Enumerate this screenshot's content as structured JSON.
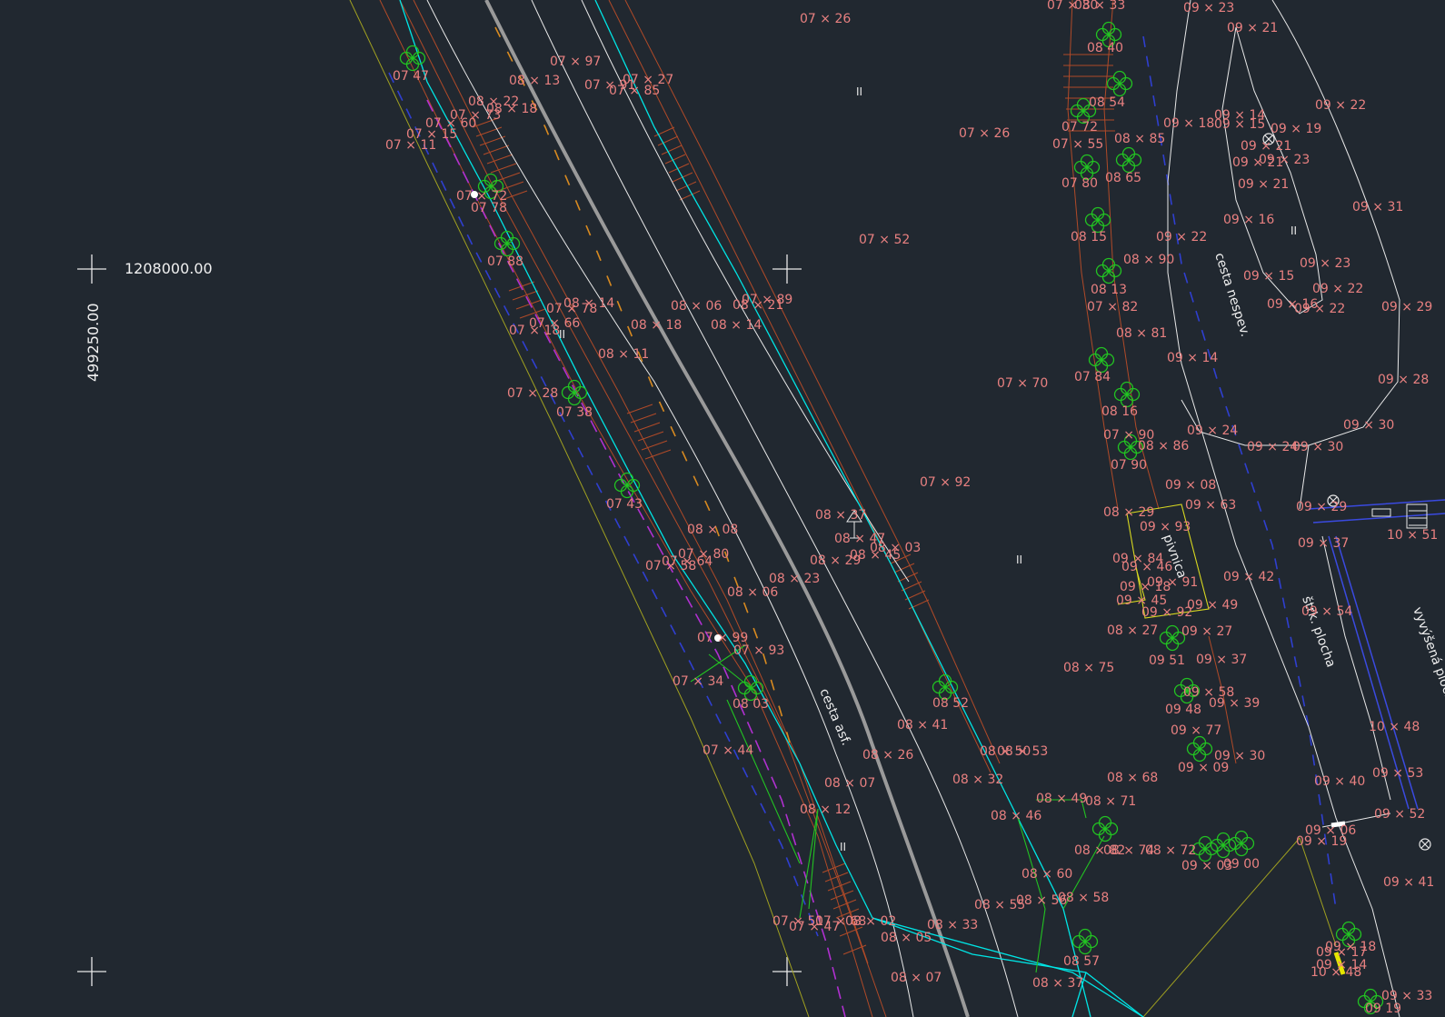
{
  "colors": {
    "background": "#212830",
    "point_label": "#e88080",
    "point_marker": "#e6e600",
    "tree": "#22c322",
    "cyan_line": "#00e5e5",
    "white_line": "#e8e8e8",
    "brown_line": "#b04a28",
    "olive_line": "#a0a020",
    "blue_dash": "#2f3fd0",
    "purple_dash": "#b030d0",
    "orange_dash": "#d88a20",
    "gray_road": "#9a9a9a",
    "yellow_line": "#d8d820"
  },
  "grid": {
    "x_coord": "1208000.00",
    "y_coord": "499250.00"
  },
  "area_labels": {
    "road_asphalt": "cesta  asf.",
    "road_unpaved": "cesta  nespev.",
    "gravel_area": "štrk.  plocha",
    "raised_area": "vyvýšená  plocha",
    "cellar": "pivnica"
  },
  "hatch_marks": [
    "II",
    "II",
    "II",
    "II",
    "II",
    "II"
  ],
  "points": [
    {
      "label": "07 × 26"
    },
    {
      "label": "07 × 26"
    },
    {
      "label": "07 × 52"
    },
    {
      "label": "07 × 70"
    },
    {
      "label": "07 × 92"
    },
    {
      "label": "07 × 97"
    },
    {
      "label": "08 × 13"
    },
    {
      "label": "07 × 91"
    },
    {
      "label": "07 × 27"
    },
    {
      "label": "07 × 85"
    },
    {
      "label": "08 × 22"
    },
    {
      "label": "08 × 18"
    },
    {
      "label": "07 × 73"
    },
    {
      "label": "07 × 60"
    },
    {
      "label": "07 × 15"
    },
    {
      "label": "07 × 11"
    },
    {
      "label": "07   47"
    },
    {
      "label": "07 × 72"
    },
    {
      "label": "07   78"
    },
    {
      "label": "07   88"
    },
    {
      "label": "08 × 14"
    },
    {
      "label": "07 × 78"
    },
    {
      "label": "07 × 66"
    },
    {
      "label": "07 × 18"
    },
    {
      "label": "08 × 06"
    },
    {
      "label": "07 × 89"
    },
    {
      "label": "08 × 21"
    },
    {
      "label": "08 × 18"
    },
    {
      "label": "08 × 14"
    },
    {
      "label": "08 × 11"
    },
    {
      "label": "07 × 28"
    },
    {
      "label": "07   38"
    },
    {
      "label": "07   43"
    },
    {
      "label": "08 × 08"
    },
    {
      "label": "07 × 80"
    },
    {
      "label": "07 × 64"
    },
    {
      "label": "07 × 58"
    },
    {
      "label": "08 × 06"
    },
    {
      "label": "08 × 23"
    },
    {
      "label": "07 × 99"
    },
    {
      "label": "07 × 93"
    },
    {
      "label": "07 × 34"
    },
    {
      "label": "08   03"
    },
    {
      "label": "07 × 44"
    },
    {
      "label": "08 × 37"
    },
    {
      "label": "08 × 47"
    },
    {
      "label": "08 × 29"
    },
    {
      "label": "08 × 45"
    },
    {
      "label": "08 × 03"
    },
    {
      "label": "08 × 41"
    },
    {
      "label": "08   52"
    },
    {
      "label": "08 × 26"
    },
    {
      "label": "08 × 07"
    },
    {
      "label": "08 × 12"
    },
    {
      "label": "08 × 50"
    },
    {
      "label": "08 × 53"
    },
    {
      "label": "08 × 32"
    },
    {
      "label": "07 × 51"
    },
    {
      "label": "07 × 47"
    },
    {
      "label": "07 × 68"
    },
    {
      "label": "08 × 02"
    },
    {
      "label": "08 × 05"
    },
    {
      "label": "08 × 33"
    },
    {
      "label": "08 × 07"
    },
    {
      "label": "07 × 30"
    },
    {
      "label": "08 × 33"
    },
    {
      "label": "08   40"
    },
    {
      "label": "08   54"
    },
    {
      "label": "07   72"
    },
    {
      "label": "07 × 55"
    },
    {
      "label": "08 × 85"
    },
    {
      "label": "07   80"
    },
    {
      "label": "08   65"
    },
    {
      "label": "08   15"
    },
    {
      "label": "08 × 90"
    },
    {
      "label": "08   13"
    },
    {
      "label": "07 × 82"
    },
    {
      "label": "08 × 81"
    },
    {
      "label": "07   84"
    },
    {
      "label": "08   16"
    },
    {
      "label": "07 × 90"
    },
    {
      "label": "08 × 86"
    },
    {
      "label": "07   90"
    },
    {
      "label": "08 × 29"
    },
    {
      "label": "08 × 27"
    },
    {
      "label": "08 × 75"
    },
    {
      "label": "08 × 68"
    },
    {
      "label": "08 × 49"
    },
    {
      "label": "08 × 71"
    },
    {
      "label": "08 × 46"
    },
    {
      "label": "08 × 82"
    },
    {
      "label": "08 × 74"
    },
    {
      "label": "08 × 72"
    },
    {
      "label": "08 × 60"
    },
    {
      "label": "08 × 55"
    },
    {
      "label": "08 × 56"
    },
    {
      "label": "08 × 58"
    },
    {
      "label": "08   57"
    },
    {
      "label": "08 × 37"
    },
    {
      "label": "09 × 23"
    },
    {
      "label": "09 × 21"
    },
    {
      "label": "09 × 22"
    },
    {
      "label": "09 × 14"
    },
    {
      "label": "09 × 15"
    },
    {
      "label": "09 × 19"
    },
    {
      "label": "09 × 18"
    },
    {
      "label": "09 × 21"
    },
    {
      "label": "09 × 23"
    },
    {
      "label": "09 × 21"
    },
    {
      "label": "09 × 21"
    },
    {
      "label": "09 × 31"
    },
    {
      "label": "09 × 16"
    },
    {
      "label": "09 × 22"
    },
    {
      "label": "09 × 23"
    },
    {
      "label": "09 × 15"
    },
    {
      "label": "09 × 22"
    },
    {
      "label": "09 × 16"
    },
    {
      "label": "09 × 22"
    },
    {
      "label": "09 × 29"
    },
    {
      "label": "09 × 14"
    },
    {
      "label": "09 × 28"
    },
    {
      "label": "09 × 24"
    },
    {
      "label": "09 × 30"
    },
    {
      "label": "09 × 24"
    },
    {
      "label": "09 × 30"
    },
    {
      "label": "09 × 08"
    },
    {
      "label": "09 × 63"
    },
    {
      "label": "09 × 93"
    },
    {
      "label": "09 × 29"
    },
    {
      "label": "09 × 37"
    },
    {
      "label": "09 × 84"
    },
    {
      "label": "09 × 46"
    },
    {
      "label": "09 × 42"
    },
    {
      "label": "09 × 18"
    },
    {
      "label": "09 × 91"
    },
    {
      "label": "09 × 45"
    },
    {
      "label": "09 × 92"
    },
    {
      "label": "09 × 49"
    },
    {
      "label": "09 × 54"
    },
    {
      "label": "09 × 27"
    },
    {
      "label": "09   51"
    },
    {
      "label": "09 × 37"
    },
    {
      "label": "09 × 58"
    },
    {
      "label": "09   48"
    },
    {
      "label": "09 × 39"
    },
    {
      "label": "09 × 77"
    },
    {
      "label": "09 × 30"
    },
    {
      "label": "09 × 09"
    },
    {
      "label": "09 × 40"
    },
    {
      "label": "09 × 53"
    },
    {
      "label": "09 × 52"
    },
    {
      "label": "09 × 06"
    },
    {
      "label": "09 × 19"
    },
    {
      "label": "09 × 03"
    },
    {
      "label": "09   00"
    },
    {
      "label": "09 × 41"
    },
    {
      "label": "09 × 17"
    },
    {
      "label": "09 × 14"
    },
    {
      "label": "09 × 33"
    },
    {
      "label": "10 × 51"
    },
    {
      "label": "10 × 48"
    },
    {
      "label": "10 × 48"
    },
    {
      "label": "09 × 18"
    },
    {
      "label": "09   19"
    }
  ]
}
